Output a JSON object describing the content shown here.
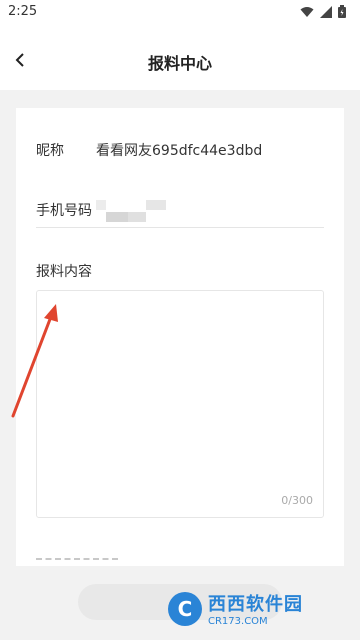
{
  "status": {
    "time": "2:25"
  },
  "header": {
    "title": "报料中心"
  },
  "form": {
    "nickname_label": "昵称",
    "nickname_value": "看看网友695dfc44e3dbd",
    "phone_label": "手机号码",
    "content_label": "报料内容",
    "counter": "0/300"
  },
  "watermark": {
    "logo": "C",
    "text": "西西软件园",
    "sub": "CR173.COM"
  },
  "colors": {
    "accent_arrow": "#e0452f",
    "background": "#f2f2f2",
    "card": "#ffffff"
  }
}
